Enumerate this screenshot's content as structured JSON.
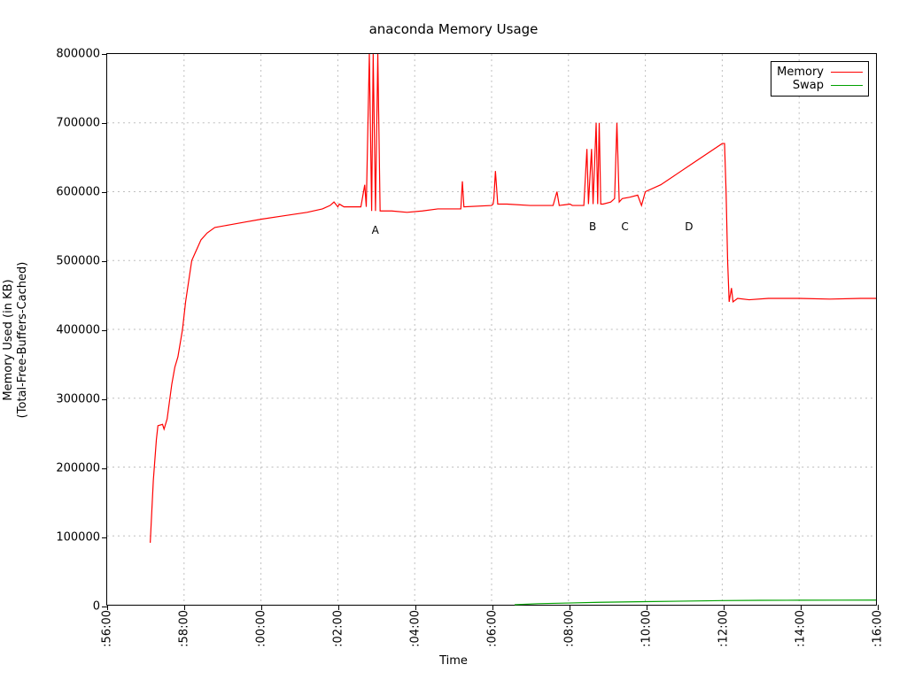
{
  "chart_data": {
    "type": "line",
    "title": "anaconda Memory Usage",
    "xlabel": "Time",
    "ylabel": "Memory Used (in KB)\n(Total-Free-Buffers-Cached)",
    "x_ticks": [
      ":56:00",
      ":58:00",
      ":00:00",
      ":02:00",
      ":04:00",
      ":06:00",
      ":08:00",
      ":10:00",
      ":12:00",
      ":14:00",
      ":16:00"
    ],
    "y_ticks": [
      0,
      100000,
      200000,
      300000,
      400000,
      500000,
      600000,
      700000,
      800000
    ],
    "xlim_index": [
      0,
      10
    ],
    "ylim": [
      0,
      800000
    ],
    "legend_position": "top-right",
    "grid": true,
    "annotations": [
      {
        "label": "A",
        "x_index": 3.48,
        "y": 545000
      },
      {
        "label": "B",
        "x_index": 6.3,
        "y": 550000
      },
      {
        "label": "C",
        "x_index": 6.72,
        "y": 550000
      },
      {
        "label": "D",
        "x_index": 7.55,
        "y": 550000
      }
    ],
    "series": [
      {
        "name": "Memory",
        "color": "#ff0000",
        "points": [
          [
            0.56,
            90000
          ],
          [
            0.6,
            180000
          ],
          [
            0.64,
            240000
          ],
          [
            0.66,
            260000
          ],
          [
            0.72,
            262000
          ],
          [
            0.74,
            255000
          ],
          [
            0.78,
            270000
          ],
          [
            0.84,
            320000
          ],
          [
            0.88,
            345000
          ],
          [
            0.92,
            360000
          ],
          [
            0.98,
            400000
          ],
          [
            1.02,
            440000
          ],
          [
            1.06,
            470000
          ],
          [
            1.1,
            500000
          ],
          [
            1.14,
            510000
          ],
          [
            1.18,
            520000
          ],
          [
            1.22,
            530000
          ],
          [
            1.3,
            540000
          ],
          [
            1.4,
            548000
          ],
          [
            1.6,
            552000
          ],
          [
            1.8,
            556000
          ],
          [
            2.0,
            560000
          ],
          [
            2.3,
            565000
          ],
          [
            2.6,
            570000
          ],
          [
            2.8,
            575000
          ],
          [
            2.9,
            580000
          ],
          [
            2.95,
            585000
          ],
          [
            3.0,
            578000
          ],
          [
            3.02,
            582000
          ],
          [
            3.05,
            580000
          ],
          [
            3.08,
            578000
          ],
          [
            3.2,
            578000
          ],
          [
            3.3,
            578000
          ],
          [
            3.35,
            610000
          ],
          [
            3.37,
            578000
          ],
          [
            3.41,
            800000
          ],
          [
            3.44,
            572000
          ],
          [
            3.46,
            800000
          ],
          [
            3.49,
            572000
          ],
          [
            3.52,
            800000
          ],
          [
            3.55,
            572000
          ],
          [
            3.6,
            572000
          ],
          [
            3.7,
            572000
          ],
          [
            3.9,
            570000
          ],
          [
            4.1,
            572000
          ],
          [
            4.3,
            575000
          ],
          [
            4.6,
            575000
          ],
          [
            4.62,
            615000
          ],
          [
            4.64,
            578000
          ],
          [
            5.0,
            580000
          ],
          [
            5.02,
            582000
          ],
          [
            5.03,
            590000
          ],
          [
            5.05,
            630000
          ],
          [
            5.08,
            582000
          ],
          [
            5.2,
            582000
          ],
          [
            5.5,
            580000
          ],
          [
            5.8,
            580000
          ],
          [
            5.85,
            600000
          ],
          [
            5.88,
            580000
          ],
          [
            6.02,
            582000
          ],
          [
            6.05,
            580000
          ],
          [
            6.2,
            580000
          ],
          [
            6.24,
            662000
          ],
          [
            6.26,
            582000
          ],
          [
            6.3,
            662000
          ],
          [
            6.32,
            582000
          ],
          [
            6.36,
            700000
          ],
          [
            6.38,
            582000
          ],
          [
            6.4,
            700000
          ],
          [
            6.42,
            582000
          ],
          [
            6.45,
            582000
          ],
          [
            6.55,
            585000
          ],
          [
            6.6,
            590000
          ],
          [
            6.63,
            700000
          ],
          [
            6.66,
            585000
          ],
          [
            6.7,
            590000
          ],
          [
            6.8,
            592000
          ],
          [
            6.9,
            595000
          ],
          [
            6.95,
            580000
          ],
          [
            7.0,
            600000
          ],
          [
            7.2,
            610000
          ],
          [
            7.4,
            625000
          ],
          [
            7.6,
            640000
          ],
          [
            7.8,
            655000
          ],
          [
            8.0,
            670000
          ],
          [
            8.03,
            670000
          ],
          [
            8.05,
            600000
          ],
          [
            8.07,
            500000
          ],
          [
            8.09,
            440000
          ],
          [
            8.12,
            460000
          ],
          [
            8.14,
            440000
          ],
          [
            8.2,
            445000
          ],
          [
            8.35,
            443000
          ],
          [
            8.6,
            445000
          ],
          [
            9.0,
            445000
          ],
          [
            9.4,
            444000
          ],
          [
            9.8,
            445000
          ],
          [
            10.0,
            445000
          ]
        ]
      },
      {
        "name": "Swap",
        "color": "#00a000",
        "points": [
          [
            5.3,
            0
          ],
          [
            5.6,
            1500
          ],
          [
            6.0,
            2500
          ],
          [
            6.4,
            3500
          ],
          [
            7.0,
            4500
          ],
          [
            7.5,
            5200
          ],
          [
            8.0,
            6000
          ],
          [
            8.5,
            6400
          ],
          [
            9.0,
            6600
          ],
          [
            9.5,
            6700
          ],
          [
            10.0,
            6750
          ]
        ]
      }
    ]
  }
}
